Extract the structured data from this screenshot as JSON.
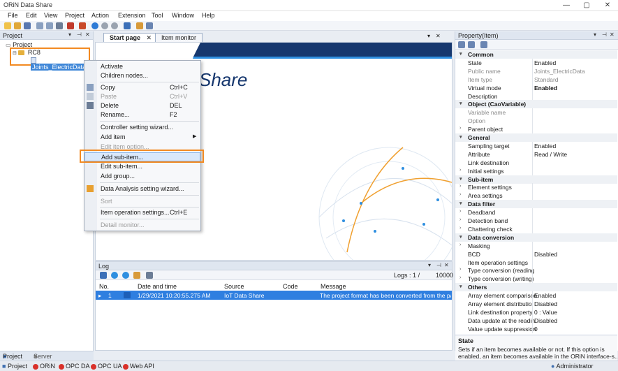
{
  "window": {
    "title": "ORiN Data Share",
    "min": "—",
    "max": "▢",
    "close": "✕"
  },
  "menu": [
    "File",
    "Edit",
    "View",
    "Project",
    "Action",
    "Extension",
    "Tool",
    "Window",
    "Help"
  ],
  "project_panel": {
    "title": "Project",
    "root": "Project",
    "controller": "RC8",
    "item": "Joints_ElectricData",
    "tabs": [
      "Project",
      "Server"
    ]
  },
  "doc_tabs": [
    {
      "label": "Start page",
      "close": "✕"
    },
    {
      "label": "Item monitor"
    }
  ],
  "start_page": {
    "brand_text": "Share"
  },
  "context_menu": {
    "items": [
      {
        "label": "Activate",
        "shortcut": ""
      },
      {
        "label": "Children nodes...",
        "shortcut": ""
      },
      {
        "label": "Copy",
        "shortcut": "Ctrl+C"
      },
      {
        "label": "Paste",
        "shortcut": "Ctrl+V"
      },
      {
        "label": "Delete",
        "shortcut": "DEL"
      },
      {
        "label": "Rename...",
        "shortcut": "F2"
      },
      {
        "label": "Controller setting wizard...",
        "shortcut": ""
      },
      {
        "label": "Add item",
        "shortcut": ""
      },
      {
        "label": "Edit item option...",
        "shortcut": ""
      },
      {
        "label": "Add sub-item...",
        "shortcut": ""
      },
      {
        "label": "Edit sub-item...",
        "shortcut": ""
      },
      {
        "label": "Add group...",
        "shortcut": ""
      },
      {
        "label": "Data Analysis setting wizard...",
        "shortcut": ""
      },
      {
        "label": "Sort",
        "shortcut": ""
      },
      {
        "label": "Item operation settings...",
        "shortcut": "Ctrl+E"
      },
      {
        "label": "Detail monitor...",
        "shortcut": ""
      }
    ]
  },
  "log": {
    "title": "Log",
    "logs_label": "Logs :",
    "logs_current": "1",
    "logs_sep": "/",
    "logs_total": "10000",
    "columns": [
      "No.",
      "Date and time",
      "Source",
      "Code",
      "Message"
    ],
    "row": {
      "no": "1",
      "datetime": "1/29/2021 10:20:55.275 AM",
      "source": "IoT Data Share",
      "code": "",
      "message": "The project format has been converted from the past"
    }
  },
  "property_panel": {
    "title": "Property(Item)",
    "rows": [
      {
        "type": "cat",
        "k": "Common"
      },
      {
        "k": "State",
        "v": "Enabled"
      },
      {
        "k": "Public name",
        "v": "Joints_ElectricData",
        "grey": true
      },
      {
        "k": "Item type",
        "v": "Standard",
        "grey": true
      },
      {
        "k": "Virtual mode",
        "v": "Enabled",
        "bold": true
      },
      {
        "k": "Description",
        "v": ""
      },
      {
        "type": "cat",
        "k": "Object (CaoVariable)"
      },
      {
        "k": "Variable name",
        "v": "",
        "grey": true
      },
      {
        "k": "Option",
        "v": "",
        "grey": true
      },
      {
        "k": "Parent object",
        "v": "",
        "expand": true
      },
      {
        "type": "cat",
        "k": "General"
      },
      {
        "k": "Sampling target",
        "v": "Enabled"
      },
      {
        "k": "Attribute",
        "v": "Read / Write"
      },
      {
        "k": "Link destination",
        "v": ""
      },
      {
        "k": "Initial settings",
        "v": "",
        "expand": true
      },
      {
        "type": "cat",
        "k": "Sub-item"
      },
      {
        "k": "Element settings",
        "v": "",
        "expand": true
      },
      {
        "k": "Area settings",
        "v": "",
        "expand": true
      },
      {
        "type": "cat",
        "k": "Data filter"
      },
      {
        "k": "Deadband",
        "v": "",
        "expand": true
      },
      {
        "k": "Detection band",
        "v": "",
        "expand": true
      },
      {
        "k": "Chattering check",
        "v": "",
        "expand": true
      },
      {
        "type": "cat",
        "k": "Data conversion"
      },
      {
        "k": "Masking",
        "v": "",
        "expand": true
      },
      {
        "k": "BCD",
        "v": "Disabled"
      },
      {
        "k": "Item operation settings",
        "v": ""
      },
      {
        "k": "Type conversion (reading",
        "v": "",
        "expand": true
      },
      {
        "k": "Type conversion (writing)",
        "v": "",
        "expand": true
      },
      {
        "type": "cat",
        "k": "Others"
      },
      {
        "k": "Array element comparison",
        "v": "Enabled"
      },
      {
        "k": "Array element distributio",
        "v": "Disabled"
      },
      {
        "k": "Link destination property",
        "v": "0 : Value"
      },
      {
        "k": "Data update at the readin",
        "v": "Disabled"
      },
      {
        "k": "Value update suppression",
        "v": "0"
      }
    ],
    "desc_title": "State",
    "desc_text1": "Sets if an item becomes available or not. If this option is",
    "desc_text2": "enabled, an item becomes available in the ORiN interface-s..."
  },
  "status_bar": {
    "items": [
      "Project",
      "ORiN",
      "OPC DA",
      "OPC UA",
      "Web API"
    ],
    "user": "Administrator"
  }
}
